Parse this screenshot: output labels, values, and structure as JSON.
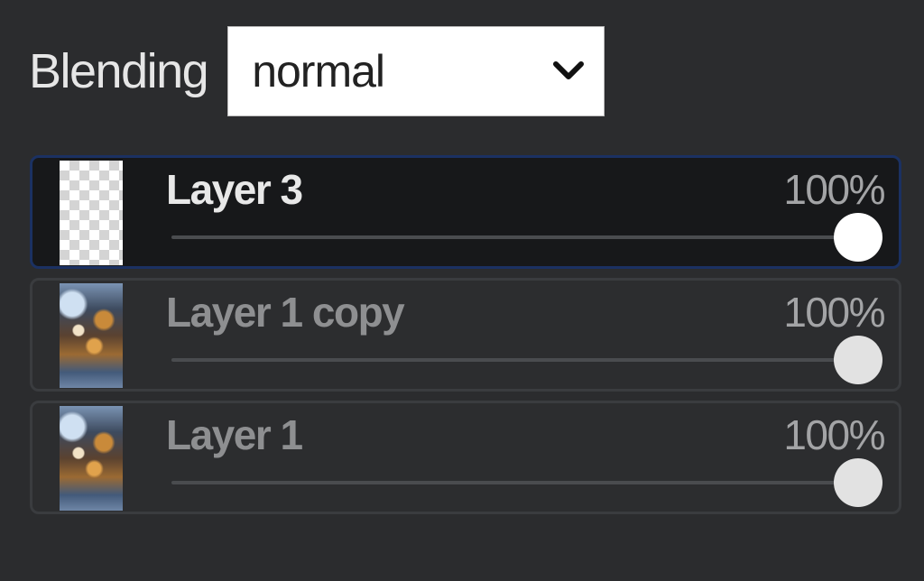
{
  "blending": {
    "label": "Blending",
    "selected": "normal",
    "chevron_icon": "chevron-down-icon"
  },
  "layers": [
    {
      "name": "Layer 3",
      "opacity_label": "100%",
      "opacity": 1.0,
      "active": true,
      "thumbnail": "transparent"
    },
    {
      "name": "Layer 1 copy",
      "opacity_label": "100%",
      "opacity": 1.0,
      "active": false,
      "thumbnail": "photo"
    },
    {
      "name": "Layer 1",
      "opacity_label": "100%",
      "opacity": 1.0,
      "active": false,
      "thumbnail": "photo"
    }
  ],
  "colors": {
    "panel_bg": "#2b2c2e",
    "active_row_bg": "#17181a",
    "active_row_border": "#1b3162"
  }
}
